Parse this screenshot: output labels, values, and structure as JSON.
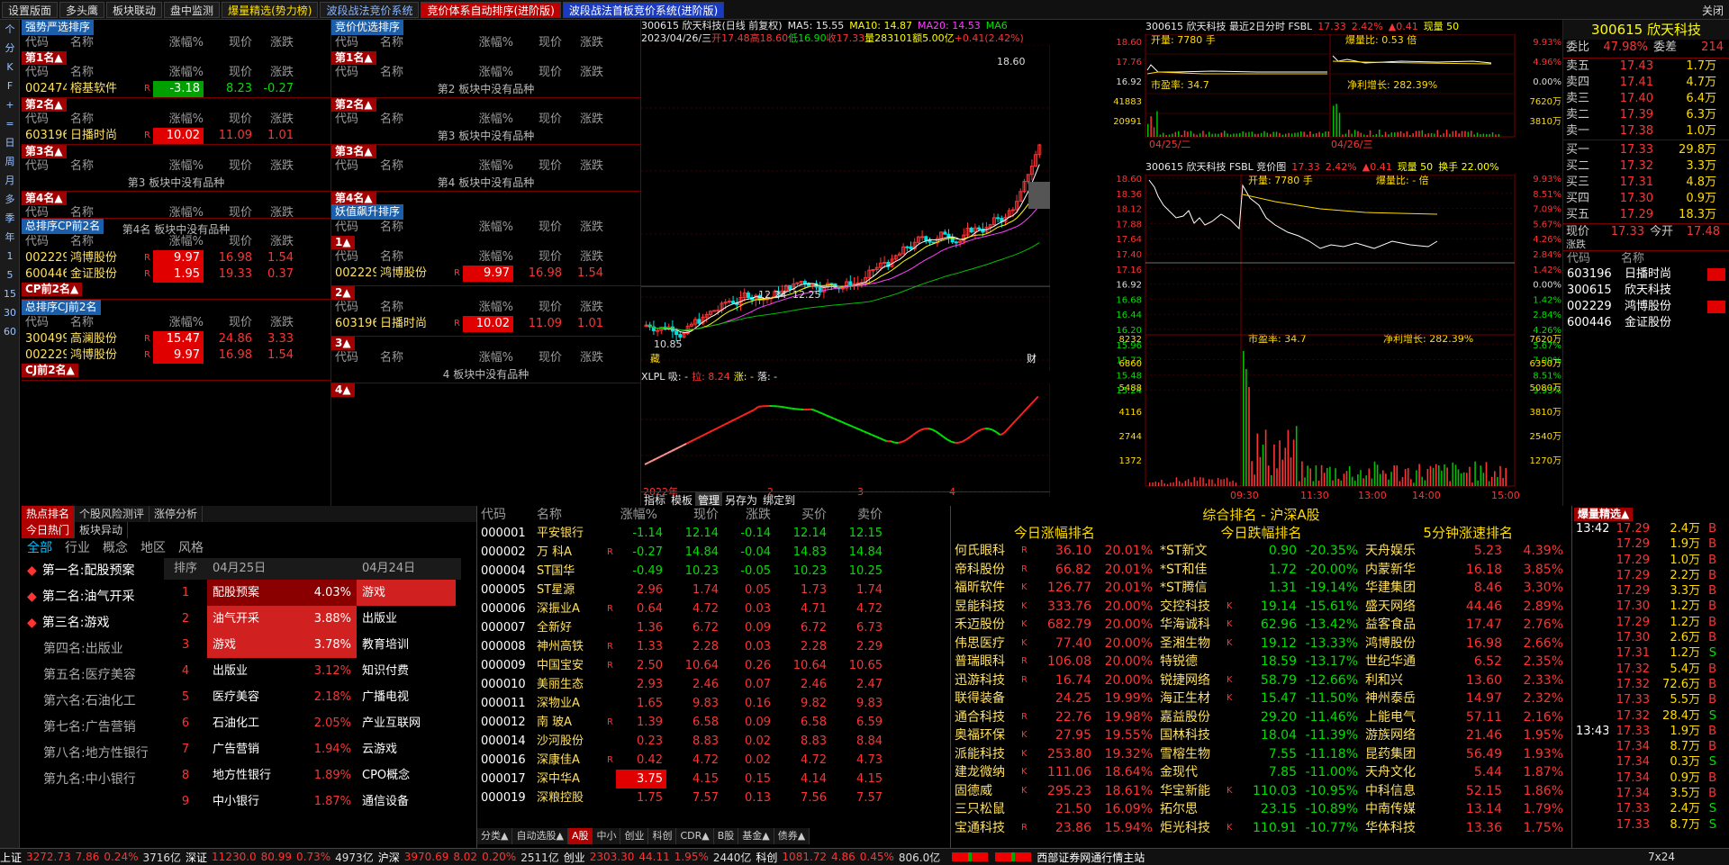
{
  "topbar": {
    "tabs": [
      "设置版面",
      "多头鹰",
      "板块联动",
      "盘中监测",
      "爆量精选(势力榜)",
      "波段战法竞价系统",
      "竞价体系自动排序(进阶版)",
      "波段战法首板竞价系统(进阶版)"
    ],
    "close": "关闭"
  },
  "lefttool": [
    "个",
    "分",
    "K",
    "F",
    "+",
    "=",
    "日",
    "周",
    "月",
    "多",
    "季",
    "年",
    "1",
    "5",
    "15",
    "30",
    "60"
  ],
  "left": {
    "sec1": {
      "title": "强势严选排序",
      "hdr": [
        "代码",
        "名称",
        "涨幅%",
        "现价",
        "涨跌"
      ]
    },
    "p1": {
      "tag": "第1名▲",
      "rows": [
        {
          "code": "002474",
          "name": "榕基软件",
          "chg": "-3.18",
          "price": "8.23",
          "diff": "-0.27"
        }
      ]
    },
    "p2": {
      "tag": "第2名▲",
      "rows": [
        {
          "code": "603196",
          "name": "日播时尚",
          "chg": "10.02",
          "price": "11.09",
          "diff": "1.01"
        }
      ]
    },
    "p3": {
      "tag": "第3名▲",
      "empty": "第3 板块中没有品种"
    },
    "p4": {
      "tag": "第4名▲",
      "empty": "第4名 板块中没有品种"
    },
    "cp": {
      "title": "总排序CP前2名",
      "rows": [
        {
          "code": "002229",
          "name": "鸿博股份",
          "chg": "9.97",
          "price": "16.98",
          "diff": "1.54"
        },
        {
          "code": "600446",
          "name": "金证股份",
          "chg": "1.95",
          "price": "19.33",
          "diff": "0.37"
        }
      ],
      "tag": "CP前2名▲"
    },
    "cj": {
      "title": "总排序CJ前2名",
      "rows": [
        {
          "code": "300499",
          "name": "高澜股份",
          "chg": "15.47",
          "price": "24.86",
          "diff": "3.33"
        },
        {
          "code": "002229",
          "name": "鸿博股份",
          "chg": "9.97",
          "price": "16.98",
          "diff": "1.54"
        }
      ],
      "tag": "CJ前2名▲"
    },
    "sec2": {
      "title": "竞价优选排序"
    },
    "q1": {
      "tag": "第1名▲",
      "empty": "第2 板块中没有品种"
    },
    "q2": {
      "tag": "第2名▲",
      "empty": "第3 板块中没有品种"
    },
    "q3": {
      "tag": "第3名▲",
      "empty": "第4 板块中没有品种"
    },
    "q4": {
      "tag": "第4名▲"
    },
    "sec3": {
      "title": "妖值飙升排序"
    },
    "y1": {
      "tag": "1▲",
      "rows": [
        {
          "code": "002229",
          "name": "鸿博股份",
          "chg": "9.97",
          "price": "16.98",
          "diff": "1.54"
        }
      ]
    },
    "y2": {
      "tag": "2▲",
      "rows": [
        {
          "code": "603196",
          "name": "日播时尚",
          "chg": "10.02",
          "price": "11.09",
          "diff": "1.01"
        }
      ]
    },
    "y3": {
      "tag": "3▲",
      "empty": "4 板块中没有品种"
    },
    "y4": {
      "tag": "4▲"
    },
    "marker": "R"
  },
  "kchart": {
    "title": "300615 欣天科技(日线 前复权)",
    "ma5": "MA5: 15.55",
    "ma10": "MA10: 14.87",
    "ma20": "MA20: 14.53",
    "ma60": "MA6",
    "date": "2023/04/26/三",
    "open": "开17.48",
    "high": "高18.60",
    "low": "低16.90",
    "close": "收17.33",
    "vol": "量283101",
    "amt": "额5.00亿",
    "pct": "+0.41(2.42%)",
    "yaxis": [
      "16.92",
      "15.23",
      "13.71",
      "12.33",
      "11.10"
    ],
    "label_high": "18.60",
    "label_low": "10.85",
    "label_a": "12.24",
    "label_b": "12.25",
    "label_c": "14.36",
    "tag": "藏",
    "tag2": "财",
    "sub_title": "XLPL 吸: -",
    "sub_la": "拉: 8.24",
    "sub_zhang": "涨: -",
    "sub_luo": "落: -",
    "sub_axis": "5.00",
    "xaxis": [
      "2022年",
      "2",
      "3",
      "4"
    ],
    "ribao": "日线",
    "bottom_tabs": [
      "指标",
      "模板",
      "管理",
      "另存为",
      "绑定到"
    ],
    "pm": [
      "+",
      "-",
      "Z"
    ]
  },
  "fenshi": {
    "title1": "300615 欣天科技 最近2日分时 FSBL",
    "price": "17.33",
    "pct": "2.42%",
    "diff": "▲0.41",
    "vol": "现量 50",
    "kaiyi": "开量: 7780 手",
    "baolb": "爆量比: 0.53 倍",
    "sy": "市盈率: 34.7",
    "jlr": "净利增长: 282.39%",
    "left1": [
      "18.60",
      "17.76",
      "16.92",
      "41883",
      "20991"
    ],
    "right1": [
      "9.93%",
      "4.96%",
      "0.00%",
      "7620万",
      "3810万"
    ],
    "dates": [
      "04/25/二",
      "04/26/三"
    ],
    "title2": "300615 欣天科技 FSBL 竞价图",
    "price2": "17.33",
    "pct2": "2.42%",
    "diff2": "▲0.41",
    "vol2": "现量 50",
    "hs": "换手 22.00%",
    "kaiyi2": "开量: 7780 手",
    "baolb2": "爆量比: - 倍",
    "sy2": "市盈率: 34.7",
    "jlr2": "净利增长: 282.39%",
    "left2": [
      "18.60",
      "18.36",
      "18.12",
      "17.88",
      "17.64",
      "17.40",
      "17.16",
      "16.92",
      "16.68",
      "16.44",
      "16.20",
      "15.96",
      "15.72",
      "15.48",
      "15.24"
    ],
    "right2": [
      "9.93%",
      "8.51%",
      "7.09%",
      "5.67%",
      "4.26%",
      "2.84%",
      "1.42%",
      "0.00%",
      "1.42%",
      "2.84%",
      "4.26%",
      "5.67%",
      "7.09%",
      "8.51%",
      "9.93%"
    ],
    "left3": [
      "8232",
      "6860",
      "5488",
      "4116",
      "2744",
      "1372"
    ],
    "right3": [
      "7620万",
      "6350万",
      "5080万",
      "3810万",
      "2540万",
      "1270万"
    ],
    "times": [
      "09:30",
      "11:30",
      "13:00",
      "14:00",
      "15:00"
    ]
  },
  "quote": {
    "code": "300615",
    "name": "欣天科技",
    "weibi": "委比",
    "weibi_v": "47.98%",
    "weicha": "委差",
    "weicha_v": "214",
    "sell": [
      {
        "l": "卖五",
        "p": "17.43",
        "v": "1.7万"
      },
      {
        "l": "卖四",
        "p": "17.41",
        "v": "4.7万"
      },
      {
        "l": "卖三",
        "p": "17.40",
        "v": "6.4万"
      },
      {
        "l": "卖二",
        "p": "17.39",
        "v": "6.3万"
      },
      {
        "l": "卖一",
        "p": "17.38",
        "v": "1.0万"
      }
    ],
    "buy": [
      {
        "l": "买一",
        "p": "17.33",
        "v": "29.8万"
      },
      {
        "l": "买二",
        "p": "17.32",
        "v": "3.3万"
      },
      {
        "l": "买三",
        "p": "17.31",
        "v": "4.8万"
      },
      {
        "l": "买四",
        "p": "17.30",
        "v": "0.9万"
      },
      {
        "l": "买五",
        "p": "17.29",
        "v": "18.3万"
      }
    ],
    "xj": "现价",
    "xj_v": "17.33",
    "jk": "今开",
    "jk_v": "17.48",
    "zd": "涨跌",
    "hdr": [
      "代码",
      "名称"
    ],
    "list": [
      {
        "c": "603196",
        "n": "日播时尚"
      },
      {
        "c": "300615",
        "n": "欣天科技"
      },
      {
        "c": "002229",
        "n": "鸿博股份"
      },
      {
        "c": "600446",
        "n": "金证股份"
      }
    ]
  },
  "hot": {
    "tabs": [
      "热点排名",
      "个股风险测评",
      "涨停分析"
    ],
    "sub": [
      "今日热门",
      "板块异动"
    ],
    "cats": [
      "全部",
      "行业",
      "概念",
      "地区",
      "风格"
    ],
    "ranks": [
      "第一名:配股预案",
      "第二名:油气开采",
      "第三名:游戏",
      "第四名:出版业",
      "第五名:医疗美容",
      "第六名:石油化工",
      "第七名:广告营销",
      "第八名:地方性银行",
      "第九名:中小银行"
    ],
    "hdr": [
      "排序",
      "04月25日",
      "04月24日"
    ],
    "tbl": [
      [
        "1",
        "配股预案",
        "4.03%",
        "游戏"
      ],
      [
        "2",
        "油气开采",
        "3.88%",
        "出版业"
      ],
      [
        "3",
        "游戏",
        "3.78%",
        "教育培训"
      ],
      [
        "4",
        "出版业",
        "3.12%",
        "知识付费"
      ],
      [
        "5",
        "医疗美容",
        "2.18%",
        "广播电视"
      ],
      [
        "6",
        "石油化工",
        "2.05%",
        "产业互联网"
      ],
      [
        "7",
        "广告营销",
        "1.94%",
        "云游戏"
      ],
      [
        "8",
        "地方性银行",
        "1.89%",
        "CPO概念"
      ],
      [
        "9",
        "中小银行",
        "1.87%",
        "通信设备"
      ]
    ]
  },
  "mkt": {
    "hdr": [
      "代码",
      "名称",
      "涨幅%",
      "现价",
      "涨跌",
      "买价",
      "卖价"
    ],
    "rows": [
      [
        "000001",
        "平安银行",
        "",
        "-1.14",
        "12.14",
        "-0.14",
        "12.14",
        "12.15"
      ],
      [
        "000002",
        "万 科A",
        "R",
        "-0.27",
        "14.84",
        "-0.04",
        "14.83",
        "14.84"
      ],
      [
        "000004",
        "ST国华",
        "",
        "-0.49",
        "10.23",
        "-0.05",
        "10.23",
        "10.25"
      ],
      [
        "000005",
        "ST星源",
        "",
        "2.96",
        "1.74",
        "0.05",
        "1.73",
        "1.74"
      ],
      [
        "000006",
        "深振业A",
        "R",
        "0.64",
        "4.72",
        "0.03",
        "4.71",
        "4.72"
      ],
      [
        "000007",
        "全新好",
        "",
        "1.36",
        "6.72",
        "0.09",
        "6.72",
        "6.73"
      ],
      [
        "000008",
        "神州高铁",
        "R",
        "1.33",
        "2.28",
        "0.03",
        "2.28",
        "2.29"
      ],
      [
        "000009",
        "中国宝安",
        "R",
        "2.50",
        "10.64",
        "0.26",
        "10.64",
        "10.65"
      ],
      [
        "000010",
        "美丽生态",
        "",
        "2.93",
        "2.46",
        "0.07",
        "2.46",
        "2.47"
      ],
      [
        "000011",
        "深物业A",
        "",
        "1.65",
        "9.83",
        "0.16",
        "9.82",
        "9.83"
      ],
      [
        "000012",
        "南 玻A",
        "R",
        "1.39",
        "6.58",
        "0.09",
        "6.58",
        "6.59"
      ],
      [
        "000014",
        "沙河股份",
        "",
        "0.23",
        "8.83",
        "0.02",
        "8.83",
        "8.84"
      ],
      [
        "000016",
        "深康佳A",
        "R",
        "0.42",
        "4.72",
        "0.02",
        "4.72",
        "4.73"
      ],
      [
        "000017",
        "深中华A",
        "",
        "3.75",
        "4.15",
        "0.15",
        "4.14",
        "4.15"
      ],
      [
        "000019",
        "深粮控股",
        "",
        "1.75",
        "7.57",
        "0.13",
        "7.56",
        "7.57"
      ]
    ],
    "tabs": [
      "分类▲",
      "自动选股▲",
      "A股",
      "中小",
      "创业",
      "科创",
      "CDR▲",
      "B股",
      "基金▲",
      "债券▲"
    ]
  },
  "zh": {
    "title": "综合排名 - 沪深A股",
    "h1": "今日涨幅排名",
    "h2": "今日跌幅排名",
    "h3": "5分钟涨速排名",
    "rows": [
      [
        "何氏眼科",
        "R",
        "36.10",
        "20.01%",
        "*ST新文",
        "",
        "0.90",
        "-20.35%",
        "天舟娱乐",
        "",
        "5.23",
        "4.39%"
      ],
      [
        "帝科股份",
        "R",
        "66.82",
        "20.01%",
        "*ST和佳",
        "",
        "1.72",
        "-20.00%",
        "内蒙新华",
        "",
        "16.18",
        "3.85%"
      ],
      [
        "福昕软件",
        "K",
        "126.77",
        "20.01%",
        "*ST腾信",
        "",
        "1.31",
        "-19.14%",
        "华建集团",
        "",
        "8.46",
        "3.30%"
      ],
      [
        "昱能科技",
        "K",
        "333.76",
        "20.00%",
        "交控科技",
        "K",
        "19.14",
        "-15.61%",
        "盛天网络",
        "",
        "44.46",
        "2.89%"
      ],
      [
        "禾迈股份",
        "K",
        "682.79",
        "20.00%",
        "华海诚科",
        "K",
        "62.96",
        "-13.42%",
        "益客食品",
        "",
        "17.47",
        "2.76%"
      ],
      [
        "伟思医疗",
        "K",
        "77.40",
        "20.00%",
        "圣湘生物",
        "K",
        "19.12",
        "-13.33%",
        "鸿博股份",
        "",
        "16.98",
        "2.66%"
      ],
      [
        "普瑞眼科",
        "R",
        "106.08",
        "20.00%",
        "特锐德",
        "",
        "18.59",
        "-13.17%",
        "世纪华通",
        "",
        "6.52",
        "2.35%"
      ],
      [
        "迅游科技",
        "R",
        "16.74",
        "20.00%",
        "锐捷网络",
        "K",
        "58.79",
        "-12.66%",
        "利和兴",
        "",
        "13.60",
        "2.33%"
      ],
      [
        "联得装备",
        "",
        "24.25",
        "19.99%",
        "海正生材",
        "K",
        "15.47",
        "-11.50%",
        "神州泰岳",
        "",
        "14.97",
        "2.32%"
      ],
      [
        "通合科技",
        "R",
        "22.76",
        "19.98%",
        "嘉益股份",
        "",
        "29.20",
        "-11.46%",
        "上能电气",
        "",
        "57.11",
        "2.16%"
      ],
      [
        "奥福环保",
        "K",
        "27.95",
        "19.55%",
        "国林科技",
        "",
        "18.04",
        "-11.39%",
        "游族网络",
        "",
        "21.46",
        "1.95%"
      ],
      [
        "派能科技",
        "K",
        "253.80",
        "19.32%",
        "雪榕生物",
        "",
        "7.55",
        "-11.18%",
        "昆药集团",
        "",
        "56.49",
        "1.93%"
      ],
      [
        "建龙微纳",
        "K",
        "111.06",
        "18.64%",
        "金现代",
        "",
        "7.85",
        "-11.00%",
        "天舟文化",
        "",
        "5.44",
        "1.87%"
      ],
      [
        "固德威",
        "K",
        "295.23",
        "18.61%",
        "华宝新能",
        "K",
        "110.03",
        "-10.95%",
        "中科信息",
        "",
        "52.15",
        "1.86%"
      ],
      [
        "三只松鼠",
        "",
        "21.50",
        "16.09%",
        "拓尔思",
        "",
        "23.15",
        "-10.89%",
        "中南传媒",
        "",
        "13.14",
        "1.79%"
      ],
      [
        "宝通科技",
        "R",
        "23.86",
        "15.94%",
        "炬光科技",
        "K",
        "110.91",
        "-10.77%",
        "华体科技",
        "",
        "13.36",
        "1.75%"
      ]
    ]
  },
  "ticks": {
    "title": "爆量精选▲",
    "first_time": "13:42",
    "second_time": "13:43",
    "rows": [
      [
        "17.29",
        "2.4万",
        "B"
      ],
      [
        "17.29",
        "1.9万",
        "B"
      ],
      [
        "17.29",
        "1.0万",
        "B"
      ],
      [
        "17.29",
        "2.2万",
        "B"
      ],
      [
        "17.29",
        "3.3万",
        "B"
      ],
      [
        "17.30",
        "1.2万",
        "B"
      ],
      [
        "17.29",
        "1.2万",
        "B"
      ],
      [
        "17.30",
        "2.6万",
        "B"
      ],
      [
        "17.31",
        "1.2万",
        "S"
      ],
      [
        "17.32",
        "5.4万",
        "B"
      ],
      [
        "17.32",
        "72.6万",
        "B"
      ],
      [
        "17.33",
        "5.5万",
        "B"
      ],
      [
        "17.32",
        "28.4万",
        "S"
      ],
      [
        "17.33",
        "1.9万",
        "B"
      ],
      [
        "17.34",
        "8.7万",
        "B"
      ],
      [
        "17.34",
        "0.3万",
        "S"
      ],
      [
        "17.34",
        "0.9万",
        "B"
      ],
      [
        "17.34",
        "3.5万",
        "B"
      ],
      [
        "17.33",
        "2.4万",
        "S"
      ],
      [
        "17.33",
        "8.7万",
        "S"
      ]
    ]
  },
  "bottom": {
    "sh": "上证",
    "sh_v": "3272.73",
    "sh_d": "7.86",
    "sh_p": "0.24%",
    "sh_a": "3716亿",
    "sz": "深证",
    "sz_v": "11230.0",
    "sz_d": "80.99",
    "sz_p": "0.73%",
    "sz_a": "4973亿",
    "hs": "沪深",
    "hs_v": "3970.69",
    "hs_d": "8.02",
    "hs_p": "0.20%",
    "hs_a": "2511亿",
    "cy": "创业",
    "cy_v": "2303.30",
    "cy_d": "44.11",
    "cy_p": "1.95%",
    "cy_a": "2440亿",
    "kc": "科创",
    "kc_v": "1081.72",
    "kc_d": "4.86",
    "kc_p": "0.45%",
    "kc_a": "806.0亿",
    "site": "西部证券网通行情主站",
    "mode": "7x24"
  },
  "colors": {
    "up": "#ff3333",
    "down": "#00e000",
    "panel": "#000000",
    "accent": "#1b5faa"
  }
}
